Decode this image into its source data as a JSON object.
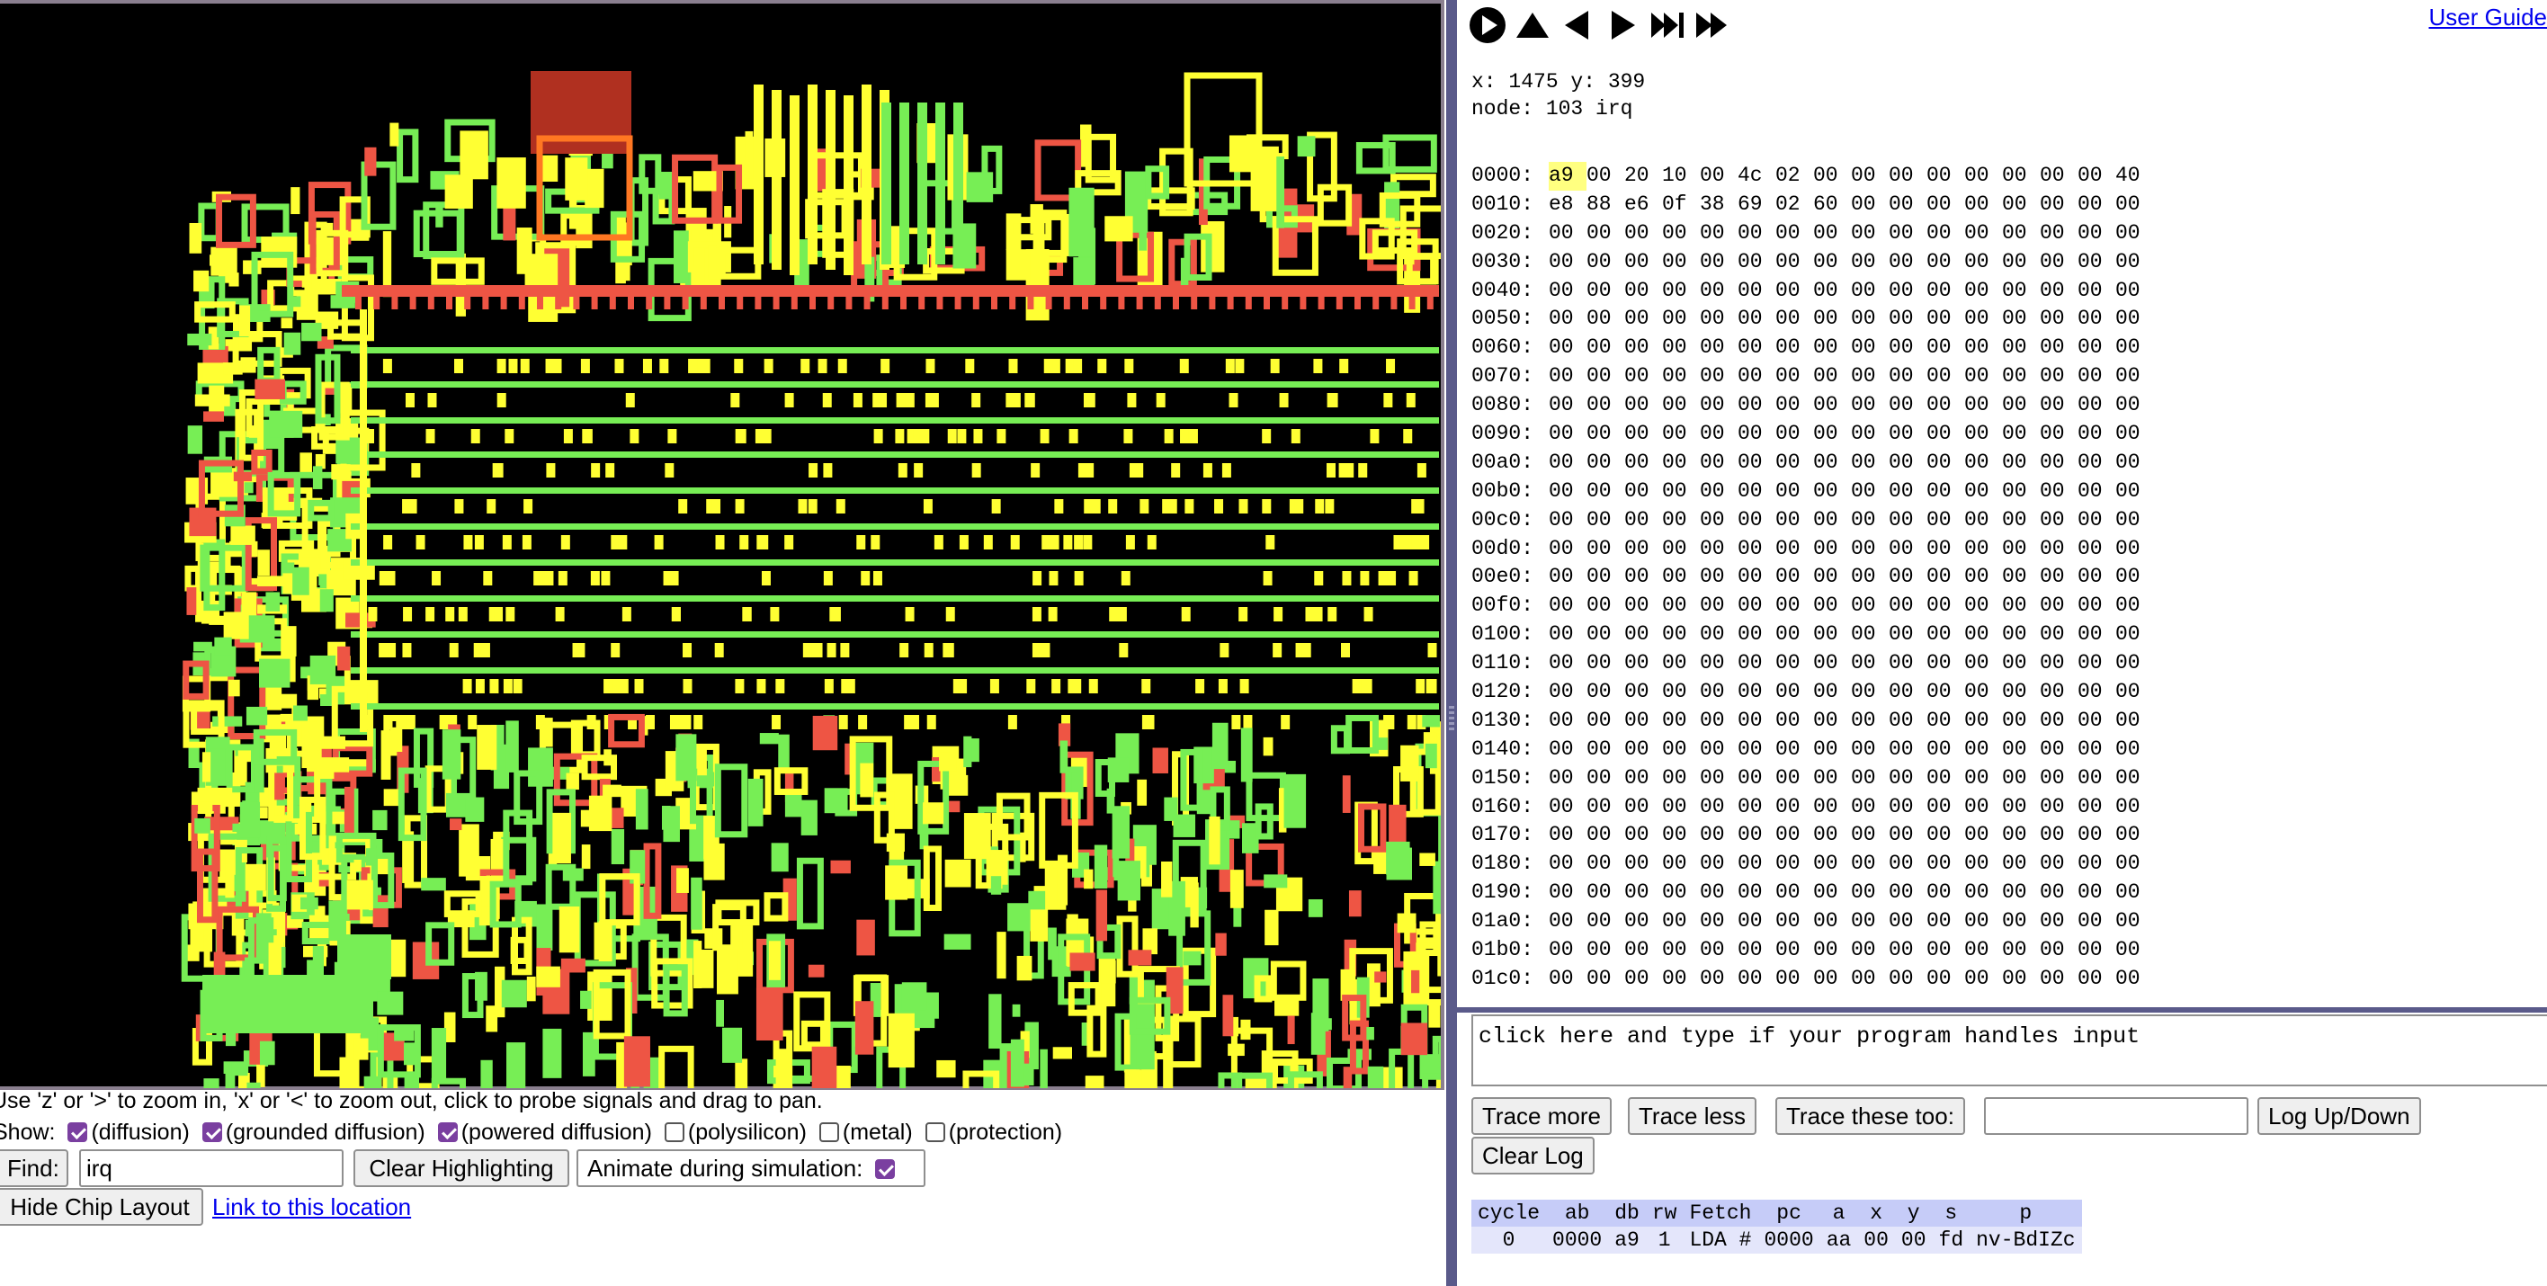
{
  "chip_colors": {
    "background": "#000000",
    "diffusion": "#ffff33",
    "grounded": "#77ee55",
    "powered": "#ee5544",
    "highlight": "#b03020",
    "highlight_trace": "#ff7722"
  },
  "help_text": "Use 'z' or '>' to zoom in, 'x' or '<' to zoom out, click to probe signals and drag to pan.",
  "show": {
    "label": "Show:",
    "options": [
      {
        "label": "(diffusion)",
        "checked": true
      },
      {
        "label": "(grounded diffusion)",
        "checked": true
      },
      {
        "label": "(powered diffusion)",
        "checked": true
      },
      {
        "label": "(polysilicon)",
        "checked": false
      },
      {
        "label": "(metal)",
        "checked": false
      },
      {
        "label": "(protection)",
        "checked": false
      }
    ]
  },
  "find": {
    "button": "Find:",
    "value": "irq"
  },
  "clear_highlighting": "Clear Highlighting",
  "animate": {
    "label": "Animate during simulation:",
    "checked": true
  },
  "hide_chip": "Hide Chip Layout",
  "link_location": "Link to this location",
  "user_guide": "User Guide",
  "playbar_icons": [
    "play-icon",
    "step-up-icon",
    "step-back-icon",
    "step-forward-icon",
    "fast-forward-end-icon",
    "fast-forward-icon"
  ],
  "probe": {
    "coords": "x: 1475 y: 399",
    "node": "node: 103 irq"
  },
  "memory": {
    "highlight": {
      "row": 0,
      "col": 0
    },
    "rows": [
      {
        "addr": "0000:",
        "bytes": [
          "a9",
          "00",
          "20",
          "10",
          "00",
          "4c",
          "02",
          "00",
          "00",
          "00",
          "00",
          "00",
          "00",
          "00",
          "00",
          "40"
        ]
      },
      {
        "addr": "0010:",
        "bytes": [
          "e8",
          "88",
          "e6",
          "0f",
          "38",
          "69",
          "02",
          "60",
          "00",
          "00",
          "00",
          "00",
          "00",
          "00",
          "00",
          "00"
        ]
      },
      {
        "addr": "0020:",
        "bytes": [
          "00",
          "00",
          "00",
          "00",
          "00",
          "00",
          "00",
          "00",
          "00",
          "00",
          "00",
          "00",
          "00",
          "00",
          "00",
          "00"
        ]
      },
      {
        "addr": "0030:",
        "bytes": [
          "00",
          "00",
          "00",
          "00",
          "00",
          "00",
          "00",
          "00",
          "00",
          "00",
          "00",
          "00",
          "00",
          "00",
          "00",
          "00"
        ]
      },
      {
        "addr": "0040:",
        "bytes": [
          "00",
          "00",
          "00",
          "00",
          "00",
          "00",
          "00",
          "00",
          "00",
          "00",
          "00",
          "00",
          "00",
          "00",
          "00",
          "00"
        ]
      },
      {
        "addr": "0050:",
        "bytes": [
          "00",
          "00",
          "00",
          "00",
          "00",
          "00",
          "00",
          "00",
          "00",
          "00",
          "00",
          "00",
          "00",
          "00",
          "00",
          "00"
        ]
      },
      {
        "addr": "0060:",
        "bytes": [
          "00",
          "00",
          "00",
          "00",
          "00",
          "00",
          "00",
          "00",
          "00",
          "00",
          "00",
          "00",
          "00",
          "00",
          "00",
          "00"
        ]
      },
      {
        "addr": "0070:",
        "bytes": [
          "00",
          "00",
          "00",
          "00",
          "00",
          "00",
          "00",
          "00",
          "00",
          "00",
          "00",
          "00",
          "00",
          "00",
          "00",
          "00"
        ]
      },
      {
        "addr": "0080:",
        "bytes": [
          "00",
          "00",
          "00",
          "00",
          "00",
          "00",
          "00",
          "00",
          "00",
          "00",
          "00",
          "00",
          "00",
          "00",
          "00",
          "00"
        ]
      },
      {
        "addr": "0090:",
        "bytes": [
          "00",
          "00",
          "00",
          "00",
          "00",
          "00",
          "00",
          "00",
          "00",
          "00",
          "00",
          "00",
          "00",
          "00",
          "00",
          "00"
        ]
      },
      {
        "addr": "00a0:",
        "bytes": [
          "00",
          "00",
          "00",
          "00",
          "00",
          "00",
          "00",
          "00",
          "00",
          "00",
          "00",
          "00",
          "00",
          "00",
          "00",
          "00"
        ]
      },
      {
        "addr": "00b0:",
        "bytes": [
          "00",
          "00",
          "00",
          "00",
          "00",
          "00",
          "00",
          "00",
          "00",
          "00",
          "00",
          "00",
          "00",
          "00",
          "00",
          "00"
        ]
      },
      {
        "addr": "00c0:",
        "bytes": [
          "00",
          "00",
          "00",
          "00",
          "00",
          "00",
          "00",
          "00",
          "00",
          "00",
          "00",
          "00",
          "00",
          "00",
          "00",
          "00"
        ]
      },
      {
        "addr": "00d0:",
        "bytes": [
          "00",
          "00",
          "00",
          "00",
          "00",
          "00",
          "00",
          "00",
          "00",
          "00",
          "00",
          "00",
          "00",
          "00",
          "00",
          "00"
        ]
      },
      {
        "addr": "00e0:",
        "bytes": [
          "00",
          "00",
          "00",
          "00",
          "00",
          "00",
          "00",
          "00",
          "00",
          "00",
          "00",
          "00",
          "00",
          "00",
          "00",
          "00"
        ]
      },
      {
        "addr": "00f0:",
        "bytes": [
          "00",
          "00",
          "00",
          "00",
          "00",
          "00",
          "00",
          "00",
          "00",
          "00",
          "00",
          "00",
          "00",
          "00",
          "00",
          "00"
        ]
      },
      {
        "addr": "0100:",
        "bytes": [
          "00",
          "00",
          "00",
          "00",
          "00",
          "00",
          "00",
          "00",
          "00",
          "00",
          "00",
          "00",
          "00",
          "00",
          "00",
          "00"
        ]
      },
      {
        "addr": "0110:",
        "bytes": [
          "00",
          "00",
          "00",
          "00",
          "00",
          "00",
          "00",
          "00",
          "00",
          "00",
          "00",
          "00",
          "00",
          "00",
          "00",
          "00"
        ]
      },
      {
        "addr": "0120:",
        "bytes": [
          "00",
          "00",
          "00",
          "00",
          "00",
          "00",
          "00",
          "00",
          "00",
          "00",
          "00",
          "00",
          "00",
          "00",
          "00",
          "00"
        ]
      },
      {
        "addr": "0130:",
        "bytes": [
          "00",
          "00",
          "00",
          "00",
          "00",
          "00",
          "00",
          "00",
          "00",
          "00",
          "00",
          "00",
          "00",
          "00",
          "00",
          "00"
        ]
      },
      {
        "addr": "0140:",
        "bytes": [
          "00",
          "00",
          "00",
          "00",
          "00",
          "00",
          "00",
          "00",
          "00",
          "00",
          "00",
          "00",
          "00",
          "00",
          "00",
          "00"
        ]
      },
      {
        "addr": "0150:",
        "bytes": [
          "00",
          "00",
          "00",
          "00",
          "00",
          "00",
          "00",
          "00",
          "00",
          "00",
          "00",
          "00",
          "00",
          "00",
          "00",
          "00"
        ]
      },
      {
        "addr": "0160:",
        "bytes": [
          "00",
          "00",
          "00",
          "00",
          "00",
          "00",
          "00",
          "00",
          "00",
          "00",
          "00",
          "00",
          "00",
          "00",
          "00",
          "00"
        ]
      },
      {
        "addr": "0170:",
        "bytes": [
          "00",
          "00",
          "00",
          "00",
          "00",
          "00",
          "00",
          "00",
          "00",
          "00",
          "00",
          "00",
          "00",
          "00",
          "00",
          "00"
        ]
      },
      {
        "addr": "0180:",
        "bytes": [
          "00",
          "00",
          "00",
          "00",
          "00",
          "00",
          "00",
          "00",
          "00",
          "00",
          "00",
          "00",
          "00",
          "00",
          "00",
          "00"
        ]
      },
      {
        "addr": "0190:",
        "bytes": [
          "00",
          "00",
          "00",
          "00",
          "00",
          "00",
          "00",
          "00",
          "00",
          "00",
          "00",
          "00",
          "00",
          "00",
          "00",
          "00"
        ]
      },
      {
        "addr": "01a0:",
        "bytes": [
          "00",
          "00",
          "00",
          "00",
          "00",
          "00",
          "00",
          "00",
          "00",
          "00",
          "00",
          "00",
          "00",
          "00",
          "00",
          "00"
        ]
      },
      {
        "addr": "01b0:",
        "bytes": [
          "00",
          "00",
          "00",
          "00",
          "00",
          "00",
          "00",
          "00",
          "00",
          "00",
          "00",
          "00",
          "00",
          "00",
          "00",
          "00"
        ]
      },
      {
        "addr": "01c0:",
        "bytes": [
          "00",
          "00",
          "00",
          "00",
          "00",
          "00",
          "00",
          "00",
          "00",
          "00",
          "00",
          "00",
          "00",
          "00",
          "00",
          "00"
        ]
      }
    ]
  },
  "console_placeholder": "click here and type if your program handles input",
  "trace_buttons": {
    "more": "Trace more",
    "less": "Trace less",
    "these": "Trace these too:",
    "these_value": "",
    "logupdown": "Log Up/Down",
    "clear": "Clear Log"
  },
  "trace_table": {
    "headers": [
      "cycle",
      "ab",
      "db",
      "rw",
      "Fetch",
      "pc",
      "a",
      "x",
      "y",
      "s",
      "p"
    ],
    "rows": [
      [
        "0",
        "0000",
        "a9",
        "1",
        "LDA #",
        "0000",
        "aa",
        "00",
        "00",
        "fd",
        "nv-BdIZc"
      ]
    ]
  }
}
